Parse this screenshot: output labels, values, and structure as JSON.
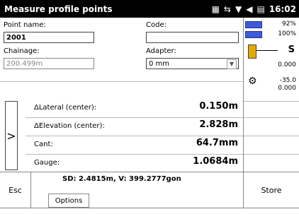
{
  "title_bar": {
    "title": "Measure profile points",
    "clock": "16:02"
  },
  "form": {
    "point_name_label": "Point name:",
    "point_name_value": "2001",
    "code_label": "Code:",
    "code_value": "",
    "chainage_label": "Chainage:",
    "chainage_value": "200.499m",
    "adapter_label": "Adapter:",
    "adapter_value": "0 mm"
  },
  "measurements": [
    {
      "name": "ΔLateral (center):",
      "value": "0.150m"
    },
    {
      "name": "ΔElevation (center):",
      "value": "2.828m"
    },
    {
      "name": "Cant:",
      "value": "64.7mm"
    },
    {
      "name": "Gauge:",
      "value": "1.0684m"
    }
  ],
  "side_panel": {
    "battery1": "92%",
    "battery2": "100%",
    "s_label": "S",
    "s_value": "0.000",
    "val1": "-35.0",
    "val2": "0.000"
  },
  "bottom": {
    "esc_label": "Esc",
    "sd_line": "SD: 2.4815m, V: 399.2777gon",
    "options_label": "Options",
    "store_label": "Store"
  },
  "colors": {
    "titlebar": "#000000",
    "battery": "#3d5bd8"
  }
}
